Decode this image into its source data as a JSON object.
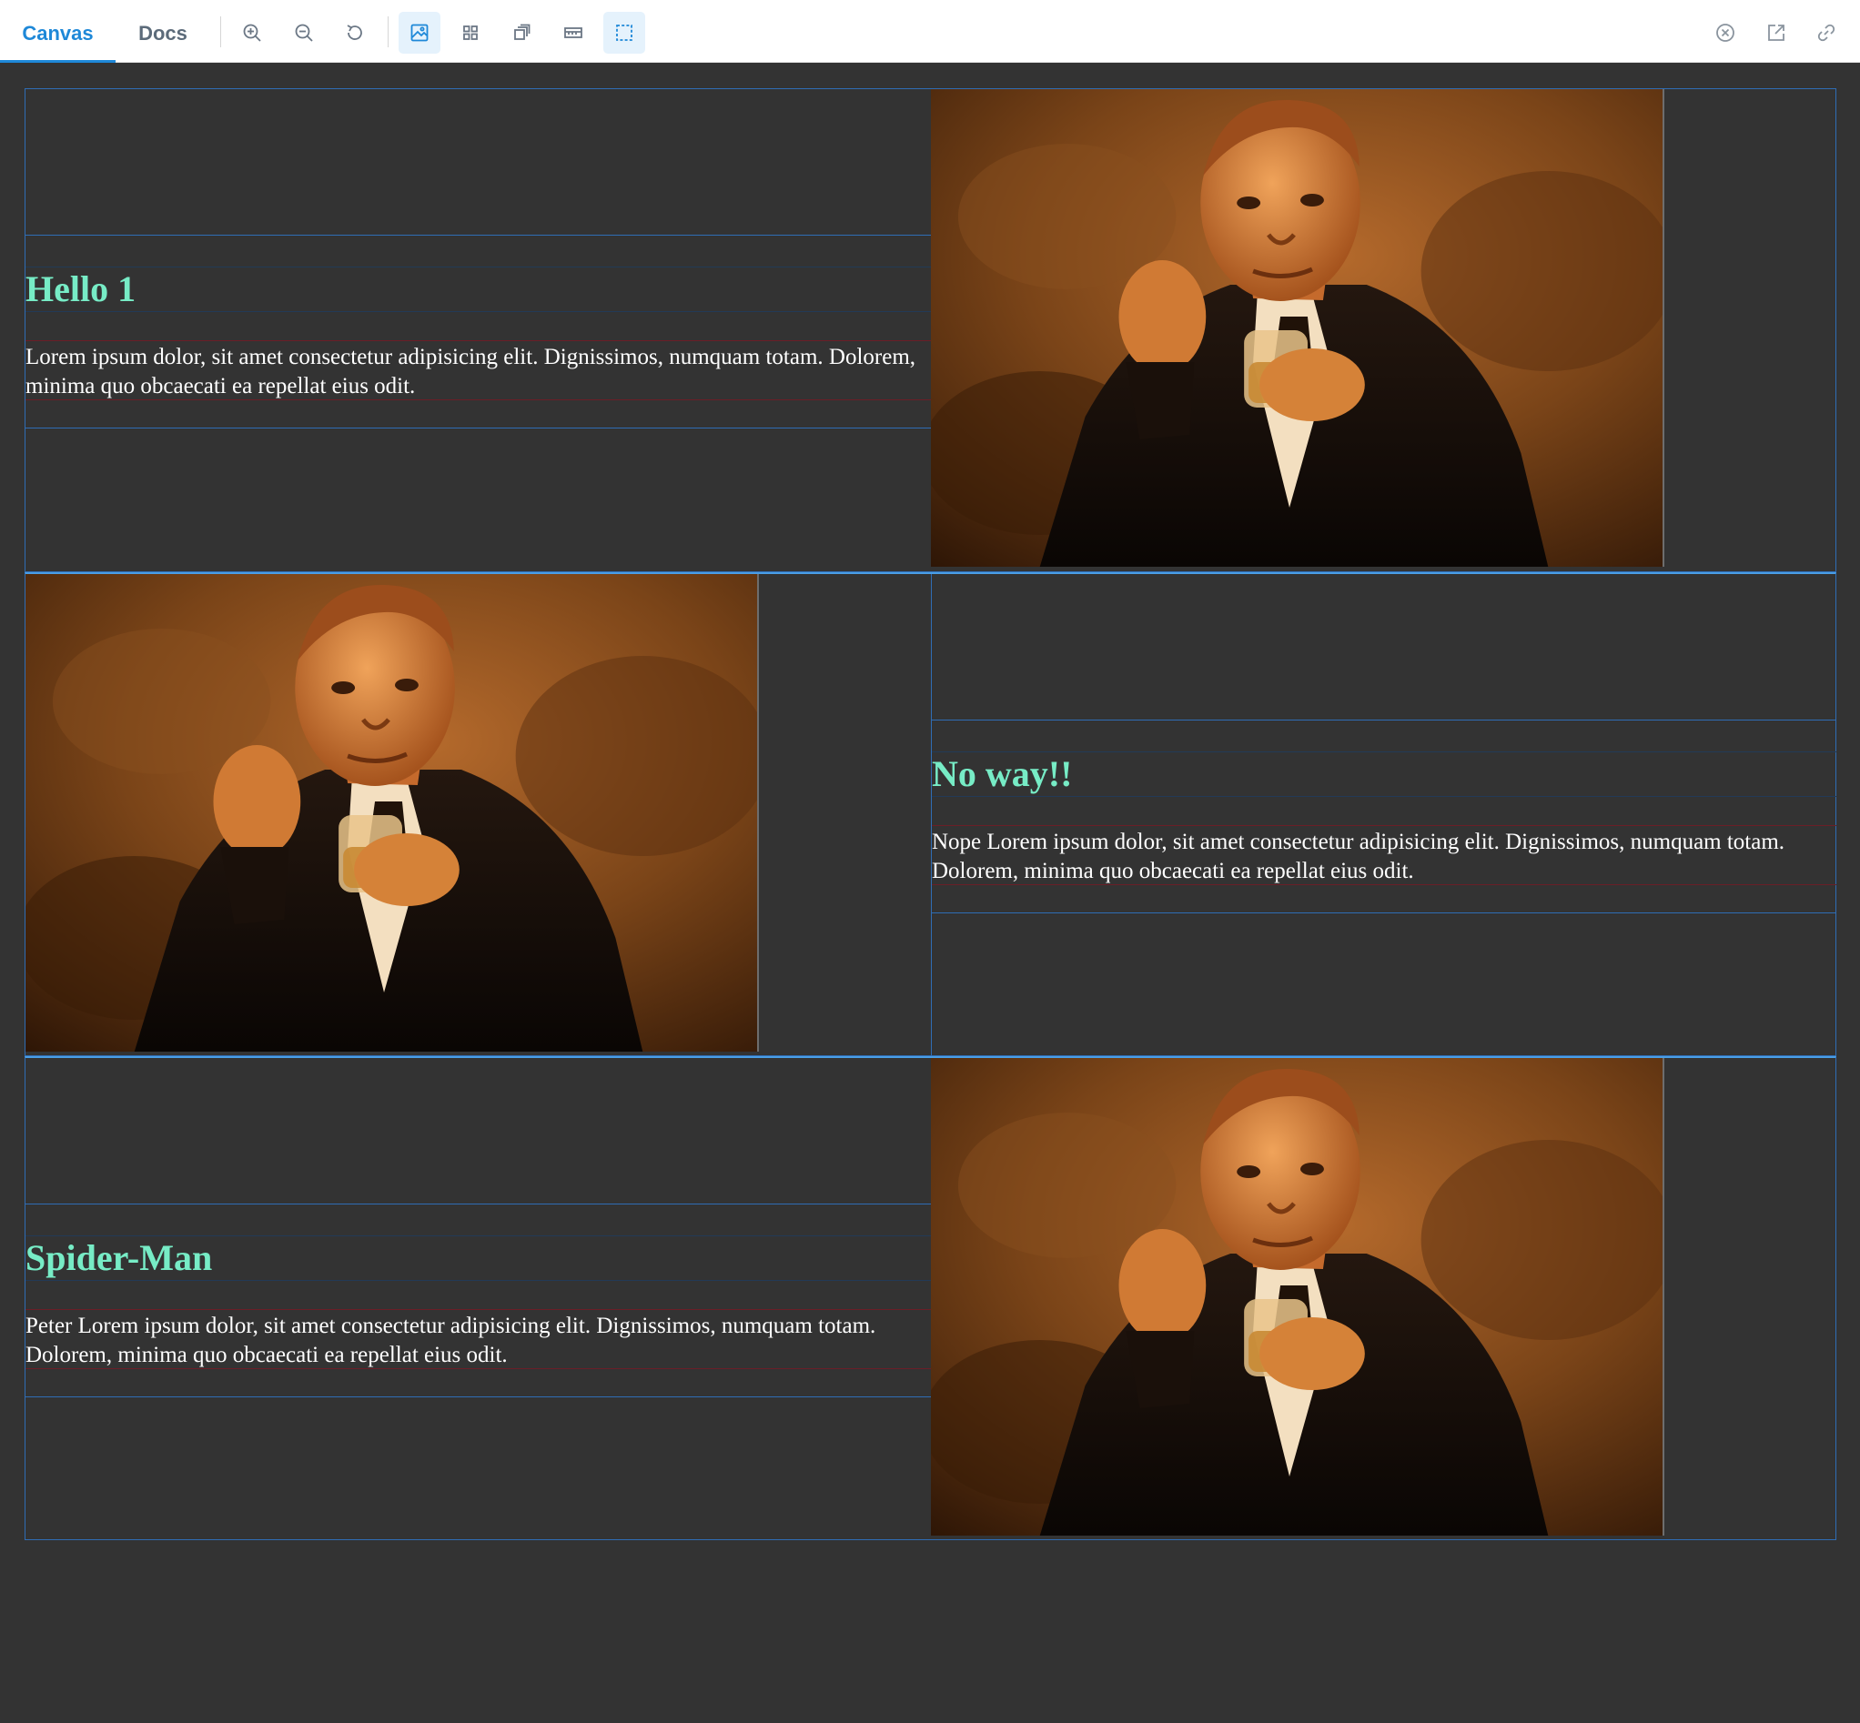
{
  "toolbar": {
    "tabs": [
      {
        "label": "Canvas",
        "active": true
      },
      {
        "label": "Docs",
        "active": false
      }
    ],
    "tools": [
      {
        "icon": "zoom-in-icon"
      },
      {
        "icon": "zoom-out-icon"
      },
      {
        "icon": "reset-zoom-icon"
      },
      {
        "icon": "background-icon",
        "active": true
      },
      {
        "icon": "grid-icon"
      },
      {
        "icon": "viewport-icon"
      },
      {
        "icon": "measure-icon"
      },
      {
        "icon": "outline-icon",
        "active": true
      }
    ],
    "right_tools": [
      {
        "icon": "close-icon"
      },
      {
        "icon": "open-new-tab-icon"
      },
      {
        "icon": "copy-link-icon"
      }
    ],
    "accent": "#1e88d8"
  },
  "sections": [
    {
      "layout": "text-left",
      "title": "Hello 1",
      "text": "Lorem ipsum dolor, sit amet consectetur adipisicing elit. Dignissimos, numquam totam. Dolorem, minima quo obcaecati ea repellat eius odit."
    },
    {
      "layout": "text-right",
      "title": "No way!!",
      "text": "Nope Lorem ipsum dolor, sit amet consectetur adipisicing elit. Dignissimos, numquam totam. Dolorem, minima quo obcaecati ea repellat eius odit."
    },
    {
      "layout": "text-left",
      "title": "Spider-Man",
      "text": "Peter Lorem ipsum dolor, sit amet consectetur adipisicing elit. Dignissimos, numquam totam. Dolorem, minima quo obcaecati ea repellat eius odit."
    }
  ],
  "colors": {
    "heading": "#77ecc6",
    "body_text": "#ffffff",
    "canvas_bg": "#333333",
    "outline": "#2f6db5"
  }
}
